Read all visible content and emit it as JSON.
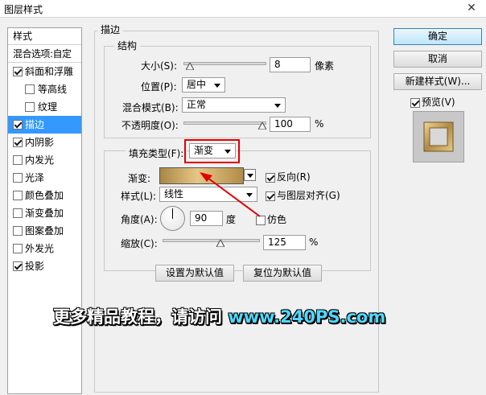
{
  "window": {
    "title": "图层样式",
    "close_glyph": "✕"
  },
  "style_list": {
    "header": "样式",
    "blend_options": "混合选项:自定",
    "items": [
      {
        "label": "斜面和浮雕",
        "checked": true,
        "indent": false,
        "selected": false
      },
      {
        "label": "等高线",
        "checked": false,
        "indent": true,
        "selected": false
      },
      {
        "label": "纹理",
        "checked": false,
        "indent": true,
        "selected": false
      },
      {
        "label": "描边",
        "checked": true,
        "indent": false,
        "selected": true
      },
      {
        "label": "内阴影",
        "checked": true,
        "indent": false,
        "selected": false
      },
      {
        "label": "内发光",
        "checked": false,
        "indent": false,
        "selected": false
      },
      {
        "label": "光泽",
        "checked": false,
        "indent": false,
        "selected": false
      },
      {
        "label": "颜色叠加",
        "checked": false,
        "indent": false,
        "selected": false
      },
      {
        "label": "渐变叠加",
        "checked": false,
        "indent": false,
        "selected": false
      },
      {
        "label": "图案叠加",
        "checked": false,
        "indent": false,
        "selected": false
      },
      {
        "label": "外发光",
        "checked": false,
        "indent": false,
        "selected": false
      },
      {
        "label": "投影",
        "checked": true,
        "indent": false,
        "selected": false
      }
    ]
  },
  "stroke": {
    "section_title": "描边",
    "structure_title": "结构",
    "size": {
      "label": "大小(S):",
      "value": "8",
      "unit": "像素",
      "slider_pct": 0.03
    },
    "position": {
      "label": "位置(P):",
      "value": "居中"
    },
    "blend_mode": {
      "label": "混合模式(B):",
      "value": "正常"
    },
    "opacity": {
      "label": "不透明度(O):",
      "value": "100",
      "unit": "%",
      "slider_pct": 1.0
    },
    "fill_type": {
      "label": "填充类型(F):",
      "value": "渐变"
    },
    "gradient": {
      "label": "渐变:",
      "reverse_label": "反向(R)",
      "reverse_checked": true
    },
    "style": {
      "label": "样式(L):",
      "value": "线性",
      "align_label": "与图层对齐(G)",
      "align_checked": true
    },
    "angle": {
      "label": "角度(A):",
      "value": "90",
      "unit": "度",
      "dither_label": "仿色",
      "dither_checked": false
    },
    "scale": {
      "label": "缩放(C):",
      "value": "125",
      "unit": "%",
      "slider_pct": 0.6
    },
    "set_default": "设置为默认值",
    "reset_default": "复位为默认值"
  },
  "actions": {
    "ok": "确定",
    "cancel": "取消",
    "new_style": "新建样式(W)...",
    "preview_label": "预览(V)",
    "preview_checked": true
  },
  "watermark": {
    "text": "更多精品教程，请访问 ",
    "url": "www.240PS.com"
  },
  "colors": {
    "selection": "#3399ff",
    "highlight": "#e10000",
    "gradient_start": "#a98744",
    "gradient_mid": "#e7c686",
    "gradient_end": "#b28c47",
    "watermark_url": "#4fd8ff"
  }
}
